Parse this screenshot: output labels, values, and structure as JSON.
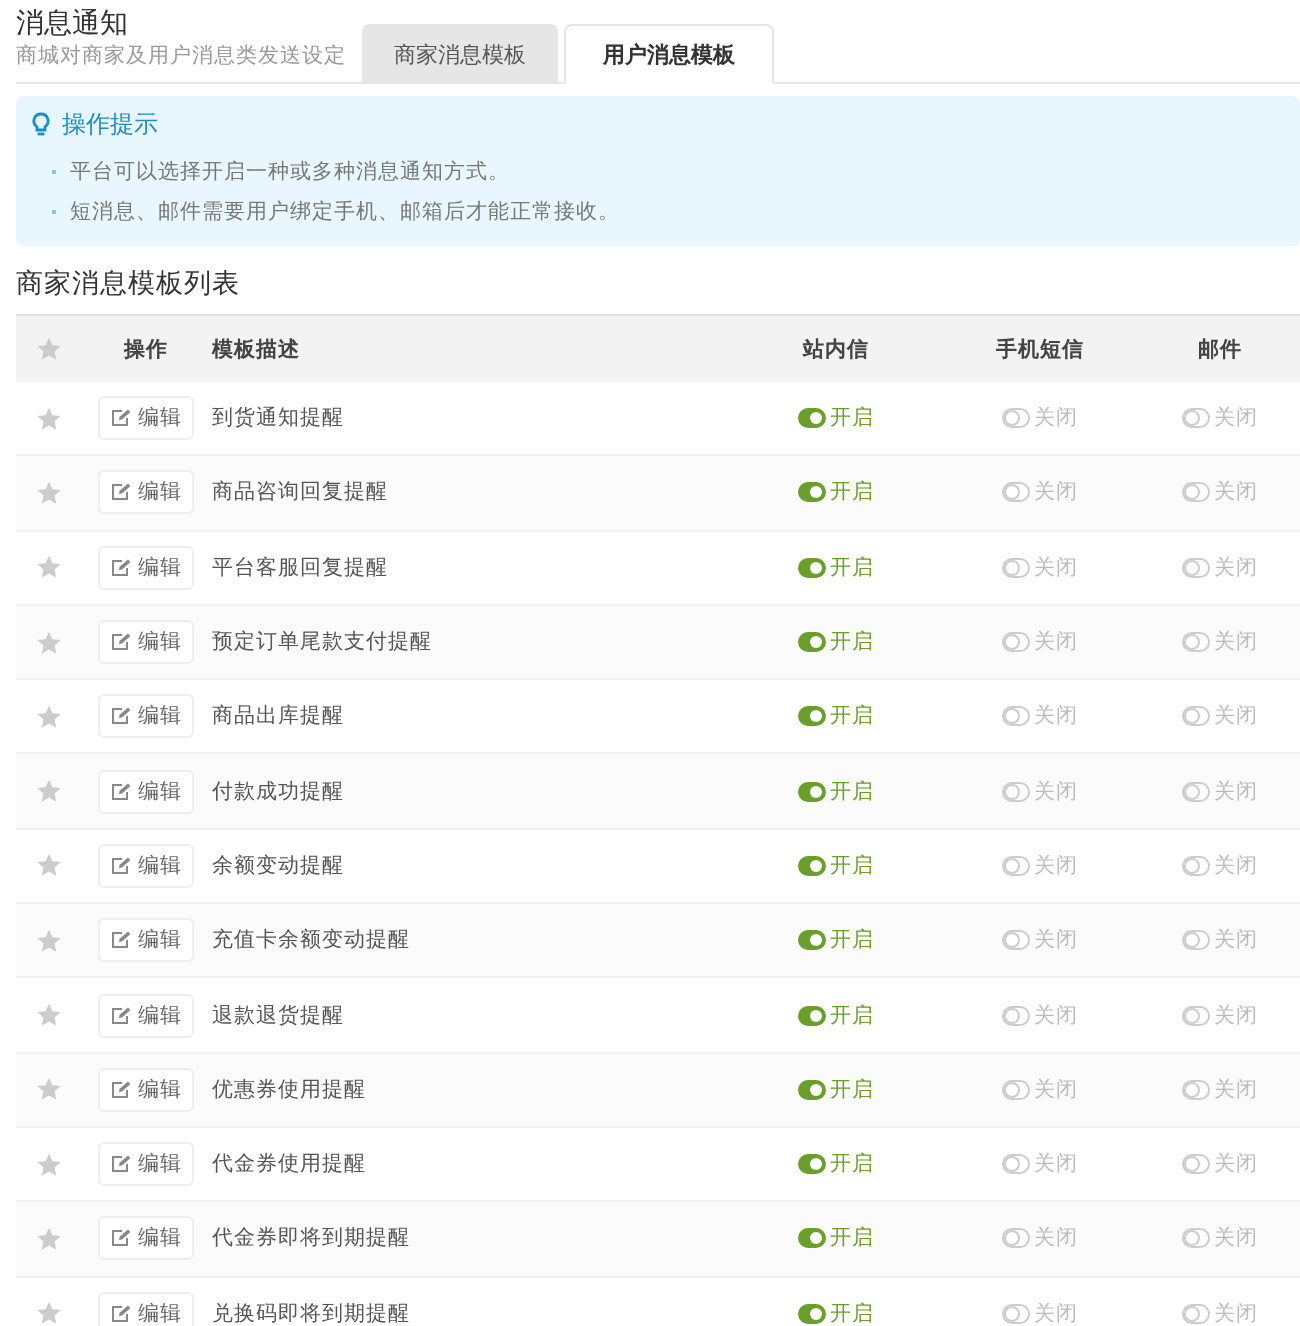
{
  "header": {
    "title": "消息通知",
    "subtitle": "商城对商家及用户消息类发送设定"
  },
  "tabs": [
    {
      "label": "商家消息模板",
      "selected": false
    },
    {
      "label": "用户消息模板",
      "selected": true
    }
  ],
  "tips": {
    "title": "操作提示",
    "items": [
      "平台可以选择开启一种或多种消息通知方式。",
      "短消息、邮件需要用户绑定手机、邮箱后才能正常接收。"
    ]
  },
  "list_title": "商家消息模板列表",
  "table": {
    "columns": [
      "操作",
      "模板描述",
      "站内信",
      "手机短信",
      "邮件"
    ],
    "rows": [
      {
        "action": "编辑",
        "description": "到货通知提醒",
        "channels": [
          {
            "label": "开启",
            "on": true
          },
          {
            "label": "关闭",
            "on": false
          },
          {
            "label": "关闭",
            "on": false
          }
        ]
      },
      {
        "action": "编辑",
        "description": "商品咨询回复提醒",
        "channels": [
          {
            "label": "开启",
            "on": true
          },
          {
            "label": "关闭",
            "on": false
          },
          {
            "label": "关闭",
            "on": false
          }
        ]
      },
      {
        "action": "编辑",
        "description": "平台客服回复提醒",
        "channels": [
          {
            "label": "开启",
            "on": true
          },
          {
            "label": "关闭",
            "on": false
          },
          {
            "label": "关闭",
            "on": false
          }
        ]
      },
      {
        "action": "编辑",
        "description": "预定订单尾款支付提醒",
        "channels": [
          {
            "label": "开启",
            "on": true
          },
          {
            "label": "关闭",
            "on": false
          },
          {
            "label": "关闭",
            "on": false
          }
        ]
      },
      {
        "action": "编辑",
        "description": "商品出库提醒",
        "channels": [
          {
            "label": "开启",
            "on": true
          },
          {
            "label": "关闭",
            "on": false
          },
          {
            "label": "关闭",
            "on": false
          }
        ]
      },
      {
        "action": "编辑",
        "description": "付款成功提醒",
        "channels": [
          {
            "label": "开启",
            "on": true
          },
          {
            "label": "关闭",
            "on": false
          },
          {
            "label": "关闭",
            "on": false
          }
        ]
      },
      {
        "action": "编辑",
        "description": "余额变动提醒",
        "channels": [
          {
            "label": "开启",
            "on": true
          },
          {
            "label": "关闭",
            "on": false
          },
          {
            "label": "关闭",
            "on": false
          }
        ]
      },
      {
        "action": "编辑",
        "description": "充值卡余额变动提醒",
        "channels": [
          {
            "label": "开启",
            "on": true
          },
          {
            "label": "关闭",
            "on": false
          },
          {
            "label": "关闭",
            "on": false
          }
        ]
      },
      {
        "action": "编辑",
        "description": "退款退货提醒",
        "channels": [
          {
            "label": "开启",
            "on": true
          },
          {
            "label": "关闭",
            "on": false
          },
          {
            "label": "关闭",
            "on": false
          }
        ]
      },
      {
        "action": "编辑",
        "description": "优惠券使用提醒",
        "channels": [
          {
            "label": "开启",
            "on": true
          },
          {
            "label": "关闭",
            "on": false
          },
          {
            "label": "关闭",
            "on": false
          }
        ]
      },
      {
        "action": "编辑",
        "description": "代金券使用提醒",
        "channels": [
          {
            "label": "开启",
            "on": true
          },
          {
            "label": "关闭",
            "on": false
          },
          {
            "label": "关闭",
            "on": false
          }
        ]
      },
      {
        "action": "编辑",
        "description": "代金券即将到期提醒",
        "channels": [
          {
            "label": "开启",
            "on": true
          },
          {
            "label": "关闭",
            "on": false
          },
          {
            "label": "关闭",
            "on": false
          }
        ]
      },
      {
        "action": "编辑",
        "description": "兑换码即将到期提醒",
        "channels": [
          {
            "label": "开启",
            "on": true
          },
          {
            "label": "关闭",
            "on": false
          },
          {
            "label": "关闭",
            "on": false
          }
        ]
      }
    ]
  }
}
